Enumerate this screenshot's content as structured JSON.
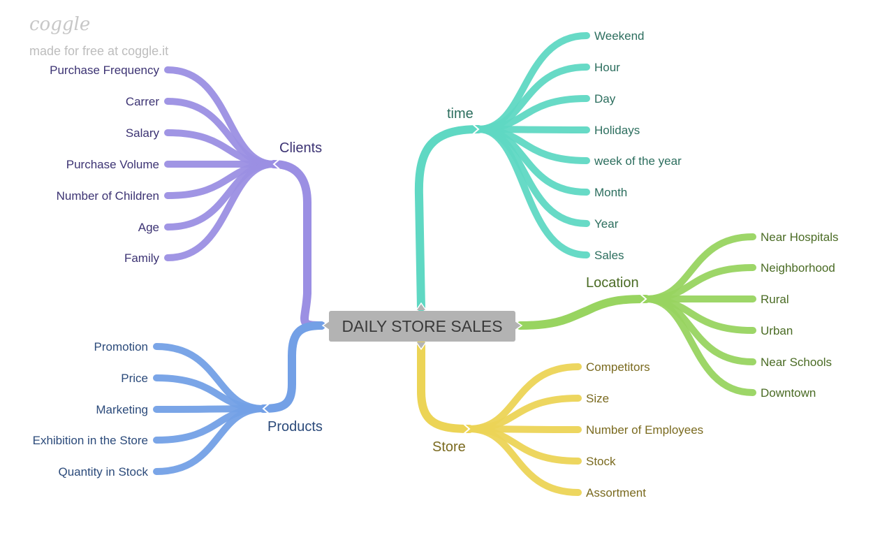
{
  "brand": {
    "logo": "coggle",
    "tagline": "made for free at coggle.it"
  },
  "root": {
    "label": "DAILY STORE SALES"
  },
  "branches": [
    {
      "id": "clients",
      "label": "Clients",
      "color": "#9b8fe3",
      "text_color": "#3c3373",
      "children": [
        "Purchase Frequency",
        "Carrer",
        "Salary",
        "Purchase Volume",
        "Number of Children",
        "Age",
        "Family"
      ]
    },
    {
      "id": "products",
      "label": "Products",
      "color": "#73a0e6",
      "text_color": "#2b4a7a",
      "children": [
        "Promotion",
        "Price",
        "Marketing",
        "Exhibition in the Store",
        "Quantity in Stock"
      ]
    },
    {
      "id": "time",
      "label": "time",
      "color": "#5fd8c3",
      "text_color": "#2c6e5e",
      "children": [
        "Weekend",
        "Hour",
        "Day",
        "Holidays",
        "week of the year",
        "Month",
        "Year",
        "Sales"
      ]
    },
    {
      "id": "location",
      "label": "Location",
      "color": "#98d460",
      "text_color": "#4a6b24",
      "children": [
        "Near Hospitals",
        "Neighborhood",
        "Rural",
        "Urban",
        "Near Schools",
        "Downtown"
      ]
    },
    {
      "id": "store",
      "label": "Store",
      "color": "#ecd456",
      "text_color": "#7a6a1f",
      "children": [
        "Competitors",
        "Size",
        "Number of Employees",
        "Stock",
        "Assortment"
      ]
    }
  ]
}
